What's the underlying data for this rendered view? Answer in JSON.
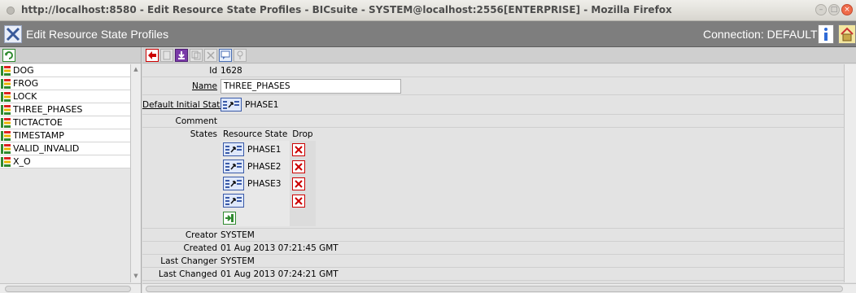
{
  "browser": {
    "title": "http://localhost:8580 - Edit Resource State Profiles - BICsuite - SYSTEM@localhost:2556[ENTERPRISE] - Mozilla Firefox"
  },
  "header": {
    "title": "Edit Resource State Profiles",
    "connection": "Connection: DEFAULT"
  },
  "sidebar": {
    "items": [
      {
        "label": "DOG"
      },
      {
        "label": "FROG"
      },
      {
        "label": "LOCK"
      },
      {
        "label": "THREE_PHASES"
      },
      {
        "label": "TICTACTOE"
      },
      {
        "label": "TIMESTAMP"
      },
      {
        "label": "VALID_INVALID"
      },
      {
        "label": "X_O"
      }
    ]
  },
  "form": {
    "id_label": "Id",
    "id_value": "1628",
    "name_label": "Name",
    "name_value": "THREE_PHASES",
    "default_initial_state_label": "Default Initial State",
    "default_initial_state_value": "PHASE1",
    "comment_label": "Comment",
    "states_label": "States",
    "states_columns": {
      "resource_state": "Resource State",
      "drop": "Drop"
    },
    "states": [
      {
        "name": "PHASE1"
      },
      {
        "name": "PHASE2"
      },
      {
        "name": "PHASE3"
      },
      {
        "name": ""
      }
    ],
    "creator_label": "Creator",
    "creator_value": "SYSTEM",
    "created_label": "Created",
    "created_value": "01 Aug 2013 07:21:45 GMT",
    "last_changer_label": "Last Changer",
    "last_changer_value": "SYSTEM",
    "last_changed_label": "Last Changed",
    "last_changed_value": "01 Aug 2013 07:24:21 GMT"
  },
  "icons": {
    "tree_item": "resource-state-profile-icon",
    "state": "resource-state-icon",
    "drop": "close-x-icon",
    "add": "add-row-icon"
  },
  "colors": {
    "header_bg": "#7e7e7e",
    "drop_red": "#cc0000",
    "add_green": "#2f8a2f"
  }
}
